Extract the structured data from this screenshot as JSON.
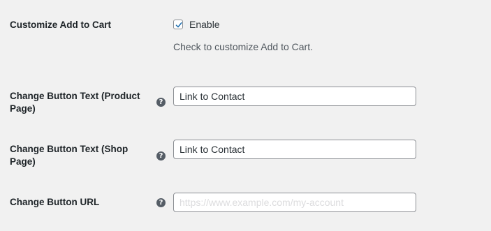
{
  "customize_add_to_cart": {
    "label": "Customize Add to Cart",
    "checkbox_label": "Enable",
    "checked": true,
    "description": "Check to customize Add to Cart."
  },
  "product_page_text": {
    "label": "Change Button Text (Product Page)",
    "value": "Link to Contact"
  },
  "shop_page_text": {
    "label": "Change Button Text (Shop Page)",
    "value": "Link to Contact"
  },
  "button_url": {
    "label": "Change Button URL",
    "placeholder": "https://www.example.com/my-account"
  },
  "help_icon": {
    "glyph": "?"
  },
  "colors": {
    "background": "#f1f1f1",
    "checkmark": "#2271b1",
    "help_icon": "#555d66",
    "input_border": "#8c8f94"
  }
}
